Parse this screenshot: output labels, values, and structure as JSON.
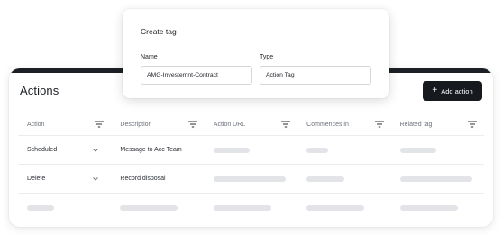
{
  "actions_panel": {
    "title": "Actions",
    "add_button_label": "Add action",
    "columns": [
      "Action",
      "Description",
      "Action URL",
      "Commences in",
      "Related tag"
    ],
    "rows": [
      {
        "action": "Scheduled",
        "description": "Message to Acc Team"
      },
      {
        "action": "Delete",
        "description": "Record disposal"
      }
    ]
  },
  "create_tag": {
    "title": "Create tag",
    "name_label": "Name",
    "name_value": "AMG-Investemnt-Contract",
    "type_label": "Type",
    "type_value": "Action Tag"
  },
  "colors": {
    "accent_dark": "#16191e",
    "skeleton": "#e3e4e7"
  },
  "icons": [
    "plus-icon",
    "filter-icon",
    "chevron-down-icon"
  ]
}
